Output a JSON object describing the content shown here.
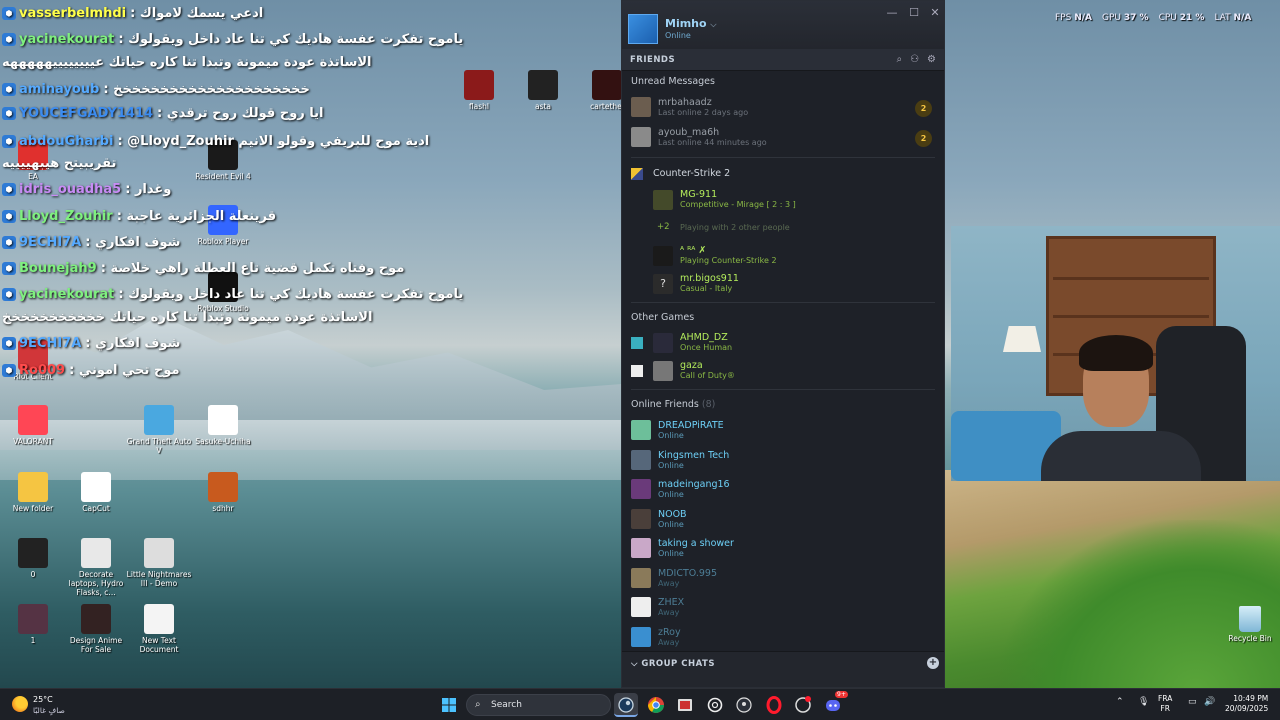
{
  "chat": [
    {
      "user": "vasserbelmhdi",
      "msg": ": ادعي يسمك لامواك",
      "color": "#ffff4a"
    },
    {
      "user": "yacinekourat",
      "msg": ": ياموح تفكرت عفسة هاديك كي تنا عاد داخل ويقولوك",
      "color": "#7ff07f"
    },
    {
      "user": "",
      "msg": "الاساتذة عودة ميمونة وتبدا تنا كاره حياتك عييييييييهههههه",
      "color": "#ffffff"
    },
    {
      "user": "aminayoub",
      "msg": ": خخخخخخخخخخخخخخخخخخخخخ",
      "color": "#56aaff"
    },
    {
      "user": "YOUCEFGADY1414",
      "msg": ": ايا روح قولك روح ترقدي",
      "color": "#3c8cf0"
    },
    {
      "user": "abdouGharbi",
      "msg": ": @Lloyd_Zouhir ادية موح للبريفي وقولو الانيم",
      "color": "#56aaff"
    },
    {
      "user": "",
      "msg": "تقريبيتح هيبهييييه",
      "color": "#ffffff"
    },
    {
      "user": "idris_ouadha5",
      "msg": ": وغدار",
      "color": "#c88cf5"
    },
    {
      "user": "Lloyd_Zouhir",
      "msg": ": قرينعلة الجزائرية عاجبة",
      "color": "#7ff07f"
    },
    {
      "user": "9ECHI7A",
      "msg": ": شوف افكاري",
      "color": "#56aaff"
    },
    {
      "user": "Bounejah9",
      "msg": ": موح وفتاه تكمل قضية تاع العطلة راهي خلاصة",
      "color": "#7ff07f"
    },
    {
      "user": "yacinekourat",
      "msg": ": ياموح تفكرت عفسة هاديك كي تنا عاد داخل ويقولوك",
      "color": "#7ff07f"
    },
    {
      "user": "",
      "msg": "الاساتذة عودة ميمونة وتبدا تنا كاره حياتك خخخخخخخخخخخ",
      "color": "#ffffff"
    },
    {
      "user": "9ECHI7A",
      "msg": ": شوف افكاري",
      "color": "#56aaff"
    },
    {
      "user": "Ro009",
      "msg": ": موح تحي اموني",
      "color": "#ff4c4c"
    }
  ],
  "desktop_icons": [
    {
      "label": "Riot Client",
      "color": "#d13639"
    },
    {
      "label": "VALORANT",
      "color": "#ff4655"
    },
    {
      "label": "New folder",
      "color": "#f5c542"
    },
    {
      "label": "CapCut",
      "color": "#ffffff"
    },
    {
      "label": "0",
      "color": "#222222"
    },
    {
      "label": "Decorate laptops, Hydro Flasks, c...",
      "color": "#e8e8e8"
    },
    {
      "label": "Little Nightmares III - Demo",
      "color": "#dddddd"
    },
    {
      "label": "1",
      "color": "#553344"
    },
    {
      "label": "Design Anime For Sale",
      "color": "#332222"
    },
    {
      "label": "New Text Document",
      "color": "#f4f4f4"
    },
    {
      "label": "EA",
      "color": "#e0302e"
    },
    {
      "label": "Resident Evil 4",
      "color": "#1a1a1a"
    },
    {
      "label": "Roblox Player",
      "color": "#3366ff"
    },
    {
      "label": "Roblox Studio",
      "color": "#111111"
    },
    {
      "label": "Grand Theft Auto V",
      "color": "#4aa8e0"
    },
    {
      "label": "Sasuke-Uchiha",
      "color": "#ffffff"
    },
    {
      "label": "sdhhr",
      "color": "#c85a1e"
    },
    {
      "label": "flashl",
      "color": "#8b1a1a"
    },
    {
      "label": "asta",
      "color": "#222222"
    },
    {
      "label": "cartethel",
      "color": "#331111"
    }
  ],
  "stats": {
    "fps_label": "FPS",
    "fps": "N/A",
    "gpu_label": "GPU",
    "gpu": "37 %",
    "cpu_label": "CPU",
    "cpu": "21 %",
    "lat_label": "LAT",
    "lat": "N/A"
  },
  "steam": {
    "user": {
      "name": "Mimho",
      "status": "Online"
    },
    "friends_label": "FRIENDS",
    "unread_title": "Unread Messages",
    "unread": [
      {
        "name": "mrbahaadz",
        "status": "Last online 2 days ago",
        "count": "2",
        "color": "#6b5d4f"
      },
      {
        "name": "ayoub_ma6h",
        "status": "Last online 44 minutes ago",
        "count": "2",
        "color": "#8a8a8a"
      }
    ],
    "cs2": {
      "title": "Counter-Strike 2",
      "players": [
        {
          "name": "MG-911",
          "status": "Competitive - Mirage [ 2 : 3 ]",
          "color": "#444a2a"
        },
        {
          "name": "",
          "status": "Playing with 2 other people",
          "extra": "+2",
          "dim": true,
          "color": "#333a22"
        },
        {
          "name": "ᴬ ᴿᴬ ✗",
          "status": "Playing Counter-Strike 2",
          "color": "#1a1a1a"
        },
        {
          "name": "mr.bigos911",
          "status": "Casual - Italy",
          "color": "#2b2b2b",
          "glyph": "?"
        }
      ]
    },
    "other_title": "Other Games",
    "other": [
      {
        "name": "AHMD_DZ",
        "status": "Once Human",
        "color": "#2a2a3a",
        "gcolor": "#3ab0c0"
      },
      {
        "name": "gaza",
        "status": "Call of Duty®",
        "color": "#777777",
        "gcolor": "#eeeeee"
      }
    ],
    "online_title": "Online Friends",
    "online_count": "(8)",
    "online": [
      {
        "name": "DREADPiRATE",
        "status": "Online",
        "state": "online",
        "color": "#6dbf9a"
      },
      {
        "name": "Kingsmen Tech",
        "status": "Online",
        "state": "online",
        "color": "#56677a"
      },
      {
        "name": "madeingang16",
        "status": "Online",
        "state": "online",
        "color": "#6a3a7a"
      },
      {
        "name": "NOOB",
        "status": "Online",
        "state": "online",
        "color": "#4a3f3a"
      },
      {
        "name": "taking a shower",
        "status": "Online",
        "state": "online",
        "color": "#c9a8c8"
      },
      {
        "name": "MDICTO.995",
        "status": "Away",
        "state": "away",
        "color": "#8a7a5a"
      },
      {
        "name": "ZHEX",
        "status": "Away",
        "state": "away",
        "color": "#eeeeee"
      },
      {
        "name": "zRoy",
        "status": "Away",
        "state": "away",
        "color": "#3a8fd0"
      }
    ],
    "group_chats_label": "GROUP CHATS"
  },
  "recycle_bin": "Recycle Bin",
  "taskbar": {
    "temp": "25°C",
    "weather": "صافٍ غالبًا",
    "search": "Search",
    "lang1": "FRA",
    "lang2": "FR",
    "time": "10:49 PM",
    "date": "20/09/2025",
    "badge": "9+"
  }
}
